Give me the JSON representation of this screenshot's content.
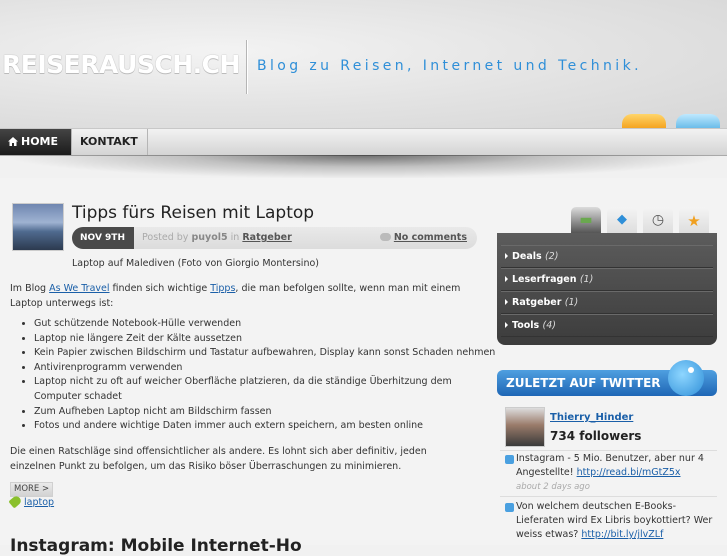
{
  "header": {
    "logo": "REISERAUSCH.CH",
    "tagline": "Blog zu Reisen, Internet und Technik."
  },
  "nav": {
    "home": "HOME",
    "kontakt": "KONTAKT"
  },
  "post": {
    "title": "Tipps fürs Reisen mit Laptop",
    "date": "NOV 9TH",
    "posted_by_prefix": "Posted by",
    "author": "puyol5",
    "in_word": "in",
    "category": "Ratgeber",
    "comments": "No comments",
    "caption": "Laptop auf Malediven (Foto von Giorgio Montersino)",
    "intro_before": "Im Blog ",
    "intro_link1": "As We Travel",
    "intro_middle": " finden sich wichtige ",
    "intro_link2": "Tipps",
    "intro_after": ", die man befolgen sollte, wenn man mit einem Laptop unterwegs ist:",
    "tips": [
      "Gut schützende Notebook-Hülle verwenden",
      "Laptop nie längere Zeit der Kälte aussetzen",
      "Kein Papier zwischen Bildschirm und Tastatur aufbewahren, Display kann sonst Schaden nehmen",
      "Antivirenprogramm verwenden",
      "Laptop nicht zu oft auf weicher Oberfläche platzieren, da die ständige Überhitzung dem Computer schadet",
      "Zum Aufheben Laptop nicht am Bildschirm fassen",
      "Fotos und andere wichtige Daten immer auch extern speichern, am besten online"
    ],
    "summary": "Die einen Ratschläge sind offensichtlicher als andere. Es lohnt sich aber definitiv, jeden einzelnen Punkt zu befolgen, um das Risiko böser Überraschungen zu minimieren.",
    "more": "MORE >",
    "tag": "laptop",
    "next_title": "Instagram: Mobile Internet-Ho"
  },
  "sidebar": {
    "tabs": [
      {
        "icon": "folder-icon",
        "glyph": "▬",
        "color": "#6aa84f"
      },
      {
        "icon": "tag-icon",
        "glyph": "◆",
        "color": "#2f8fd8"
      },
      {
        "icon": "clock-icon",
        "glyph": "◷",
        "color": "#555555"
      },
      {
        "icon": "star-icon",
        "glyph": "★",
        "color": "#f0a020"
      }
    ],
    "categories": [
      {
        "label": "Deals",
        "count": "(2)"
      },
      {
        "label": "Leserfragen",
        "count": "(1)"
      },
      {
        "label": "Ratgeber",
        "count": "(1)"
      },
      {
        "label": "Tools",
        "count": "(4)"
      }
    ]
  },
  "twitter": {
    "title": "ZULETZT AUF TWITTER",
    "user": "Thierry_Hinder",
    "followers": "734 followers",
    "tweets": [
      {
        "text": "Instagram - 5 Mio. Benutzer, aber nur 4 Angestellte! ",
        "link": "http://read.bi/mGtZ5x",
        "time": "about 2 days ago"
      },
      {
        "text": "Von welchem deutschen E-Books-Lieferaten wird Ex Libris boykottiert? Wer weiss etwas? ",
        "link": "http://bit.ly/jlvZLf",
        "time": ""
      }
    ]
  }
}
